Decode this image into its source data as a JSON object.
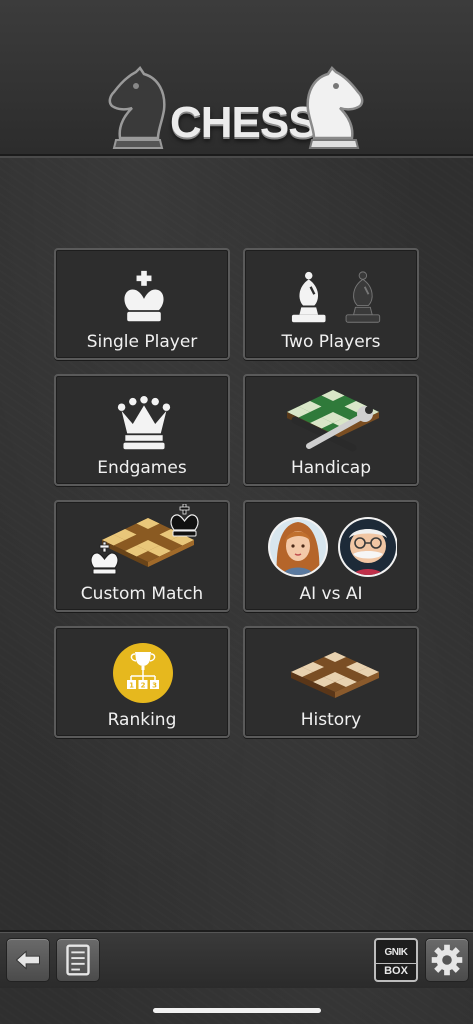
{
  "app": {
    "title": "CHESS"
  },
  "menu": {
    "single_player": {
      "label": "Single Player",
      "icon": "king-icon"
    },
    "two_players": {
      "label": "Two Players",
      "icon": "bishops-icon"
    },
    "endgames": {
      "label": "Endgames",
      "icon": "queen-icon"
    },
    "handicap": {
      "label": "Handicap",
      "icon": "board-wrench-icon"
    },
    "custom_match": {
      "label": "Custom Match",
      "icon": "board-kings-icon"
    },
    "ai_vs_ai": {
      "label": "AI vs AI",
      "icon": "ai-avatars-icon"
    },
    "ranking": {
      "label": "Ranking",
      "icon": "trophy-icon"
    },
    "history": {
      "label": "History",
      "icon": "board-icon"
    }
  },
  "ranking_badge": {
    "places": [
      "1",
      "2",
      "3"
    ]
  },
  "toolbar": {
    "back": {
      "icon": "back-arrow-icon"
    },
    "notes": {
      "icon": "notes-icon"
    },
    "brand": {
      "line1": "GNIK",
      "line2": "BOX"
    },
    "settings": {
      "icon": "gear-icon"
    }
  },
  "colors": {
    "background": "#2f2f2f",
    "tile_border": "#5a5a5a",
    "label_text": "#f1f1f1",
    "trophy_gold": "#e6b81e",
    "board_light": "#e9c77a",
    "board_dark": "#8a5a22"
  }
}
